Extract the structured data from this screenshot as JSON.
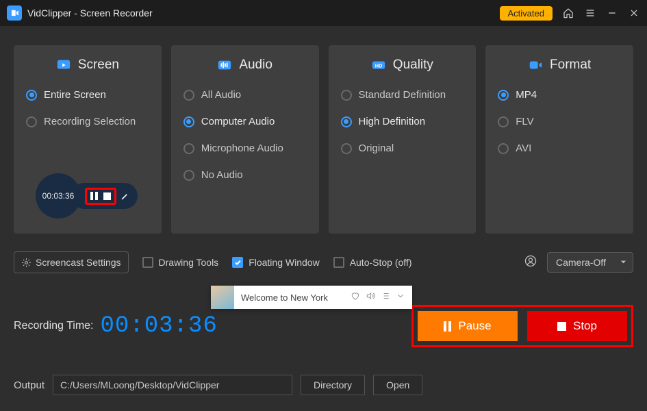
{
  "titlebar": {
    "app_title": "VidClipper - Screen Recorder",
    "activated_label": "Activated"
  },
  "cards": {
    "screen": {
      "title": "Screen",
      "options": [
        "Entire Screen",
        "Recording Selection"
      ],
      "selected_index": 0
    },
    "audio": {
      "title": "Audio",
      "options": [
        "All Audio",
        "Computer Audio",
        "Microphone Audio",
        "No Audio"
      ],
      "selected_index": 1
    },
    "quality": {
      "title": "Quality",
      "options": [
        "Standard Definition",
        "High Definition",
        "Original"
      ],
      "selected_index": 1
    },
    "format": {
      "title": "Format",
      "options": [
        "MP4",
        "FLV",
        "AVI"
      ],
      "selected_index": 0
    }
  },
  "float_widget": {
    "time": "00:03:36"
  },
  "settings_row": {
    "screencast_btn": "Screencast Settings",
    "drawing_tools": {
      "label": "Drawing Tools",
      "checked": false
    },
    "floating_window": {
      "label": "Floating Window",
      "checked": true
    },
    "auto_stop": {
      "label": "Auto-Stop  (off)",
      "checked": false
    },
    "camera_select": "Camera-Off"
  },
  "music_popup": {
    "title": "Welcome to New York"
  },
  "recording": {
    "label": "Recording Time:",
    "time": "00:03:36",
    "pause_label": "Pause",
    "stop_label": "Stop"
  },
  "output": {
    "label": "Output",
    "path": "C:/Users/MLoong/Desktop/VidClipper",
    "directory_btn": "Directory",
    "open_btn": "Open"
  }
}
